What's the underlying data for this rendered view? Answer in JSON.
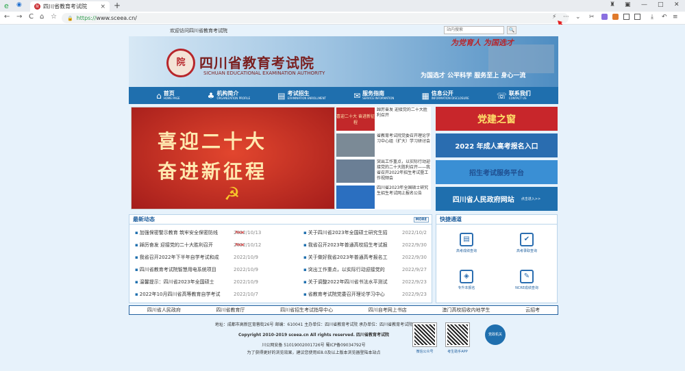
{
  "browser": {
    "tab_title": "四川省教育考试院",
    "tab_close": "×",
    "new_tab": "+",
    "url_protocol": "https://",
    "url_host": "www.sceea.cn/",
    "nav": {
      "back": "←",
      "forward": "→",
      "reload": "C",
      "home": "⌂",
      "favorite": "☆"
    },
    "window": {
      "restore": "▣",
      "minimize": "—",
      "maximize": "□",
      "close": "✕",
      "shirt": "♜"
    },
    "toolbar": {
      "lightning": "⚡",
      "more": "···",
      "expand": "⌄",
      "cut": "✂",
      "download": "⤓",
      "undo": "↶",
      "menu": "≡"
    }
  },
  "topbar": {
    "welcome": "欢迎访问四川省教育考试院",
    "search_placeholder": "站内搜索",
    "search_button": "🔍"
  },
  "banner": {
    "seal": "院",
    "title_cn": "四川省教育考试院",
    "title_en": "SICHUAN EDUCATIONAL EXAMINATION AUTHORITY",
    "slogan_top": "为党育人  为国选才",
    "slogan_bottom": "为国选才  公平科学  服务至上  身心一流"
  },
  "nav": [
    {
      "cn": "首页",
      "en": "HOME PAGE",
      "icon": "⌂"
    },
    {
      "cn": "机构简介",
      "en": "ORGANIZATION PROFILE",
      "icon": "♣"
    },
    {
      "cn": "考试招生",
      "en": "EXAMINATION ENROLLMENT",
      "icon": "▤"
    },
    {
      "cn": "服务指南",
      "en": "SERVICE INFORMATION",
      "icon": "✉"
    },
    {
      "cn": "信息公开",
      "en": "INFORMATION DISCLOSURE",
      "icon": "▦"
    },
    {
      "cn": "联系我们",
      "en": "CONTACT US",
      "icon": "☏"
    }
  ],
  "hero": {
    "line1": "喜迎二十大",
    "line2": "奋进新征程"
  },
  "news_thumbs": [
    {
      "text": "踔厉奋发 迎接党的二十大胜利召开",
      "thumb_label": "喜迎二十大 奋进新征程",
      "color": "#c2282a"
    },
    {
      "text": "省教育考试院党委召开理论学习中心组（扩大）学习研讨会",
      "color": "#7b8a96"
    },
    {
      "text": "突出工作重点，以实际行动迎接党的二十大胜利召开——我省召开2022年招生考试暨工作视频会",
      "color": "#6b7f95"
    },
    {
      "text": "四川省2023年全国硕士研究生招生考试网上报名公告",
      "color": "#2b6fc0"
    }
  ],
  "right_banners": [
    {
      "text": "党建之窗",
      "bg": "#c8262b",
      "color": "#ffe26a"
    },
    {
      "text": "2022 年成人高考报名入口",
      "bg": "#2a6db0",
      "color": "#ffffff"
    },
    {
      "text": "招生考试服务平台",
      "bg": "#3a8fd4",
      "color": "#1f4e8f"
    },
    {
      "text": "四川省人民政府网站",
      "more": "点击进入>>",
      "bg": "#1f6fae",
      "color": "#ffffff"
    }
  ],
  "latest": {
    "title": "最新动态",
    "more": "MORE",
    "items_left": [
      {
        "title": "加强保密警示教育 筑牢安全保密防线",
        "new": "New",
        "date": "2022/10/13"
      },
      {
        "title": "踔厉奋发 迎接党的二十大胜利召开",
        "new": "New",
        "date": "2022/10/12"
      },
      {
        "title": "我省召开2022年下半年自学考试和成",
        "date": "2022/10/9"
      },
      {
        "title": "四川省教育考试院智慧用电系统项目",
        "date": "2022/10/9"
      },
      {
        "title": "温馨提示：四川省2023年全国硕士",
        "date": "2022/10/9"
      },
      {
        "title": "2022年10月四川省高等教育自学考试",
        "date": "2022/10/7"
      }
    ],
    "items_right": [
      {
        "title": "关于四川省2023年全国硕士研究生招",
        "date": "2022/10/2"
      },
      {
        "title": "我省召开2023年普通高校招生考试报",
        "date": "2022/9/30"
      },
      {
        "title": "关于做好我省2023年普通高考报名工",
        "date": "2022/9/30"
      },
      {
        "title": "突出工作重点，以实际行动迎接党的",
        "date": "2022/9/27"
      },
      {
        "title": "关于调整2022年四川省书法水平测试",
        "date": "2022/9/23"
      },
      {
        "title": "省教育考试院党委召开理论学习中心",
        "date": "2022/9/23"
      }
    ]
  },
  "quick": {
    "title": "快捷通道",
    "items": [
      {
        "label": "高考成绩查询",
        "icon": "▤"
      },
      {
        "label": "高考录取查询",
        "icon": "✔"
      },
      {
        "label": "专升本报名",
        "icon": "◈"
      },
      {
        "label": "NCRE成绩查询",
        "icon": "✎"
      }
    ]
  },
  "links": [
    "四川省人民政府",
    "四川省教育厅",
    "四川省招生考试指导中心",
    "四川自考网上书店",
    "澳门高校招收内地学生",
    "云招考"
  ],
  "footer": {
    "address": "地址：成都市高新区育蓉街26号  邮编：610041  主办单位：四川省教育考试院  承办单位：四川省教育考试院",
    "copyright": "Copyright 2010-2019 sceea.cn All rights reserved. 四川省教育考试院",
    "icp": "川公网安备 51019002001726号    蜀ICP备09034792号",
    "browser_tip": "为了获得更好的浏览效果，建议您使用IE8.0及以上版本浏览器登陆本站点",
    "qr1_label": "微信公众号",
    "qr2_label": "考生助手APP",
    "badge_label": "党政机关"
  }
}
